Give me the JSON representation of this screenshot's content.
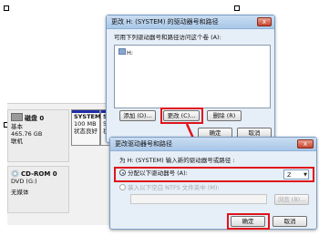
{
  "disk_panel": {
    "disk0": {
      "name": "磁盘 0",
      "type": "基本",
      "size": "465.76 GB",
      "status": "联机"
    },
    "partitions": [
      {
        "label": "SYSTEM",
        "size": "100 MB",
        "status": "状态良好"
      },
      {
        "label": "S",
        "size": "5",
        "status": "状"
      }
    ],
    "cdrom": {
      "name": "CD-ROM 0",
      "drive": "DVD (G:)",
      "media": "无媒体"
    }
  },
  "dialog1": {
    "title": "更改 H: (SYSTEM) 的驱动器号和路径",
    "instruction": "可用下列驱动器号和路径访问这个卷 (A):",
    "list_items": [
      "H:"
    ],
    "add_label": "添加 (D)...",
    "change_label": "更改 (C)...",
    "delete_label": "删除 (R)",
    "ok_label": "确定",
    "cancel_label": "取消",
    "close_glyph": "x"
  },
  "dialog2": {
    "title": "更改驱动器号和路径",
    "instruction": "为 H: (SYSTEM) 输入新的驱动器号或路径 :",
    "option1_label": "分配以下驱动器号 (A):",
    "option2_label": "装入以下空白 NTFS 文件夹中 (M):",
    "drive_letter": "Z",
    "browse_label": "浏览 (B)...",
    "ok_label": "确定",
    "cancel_label": "取消",
    "close_glyph": "x"
  },
  "colors": {
    "highlight": "#e0141b",
    "title_bar": "#b8d1ee"
  }
}
